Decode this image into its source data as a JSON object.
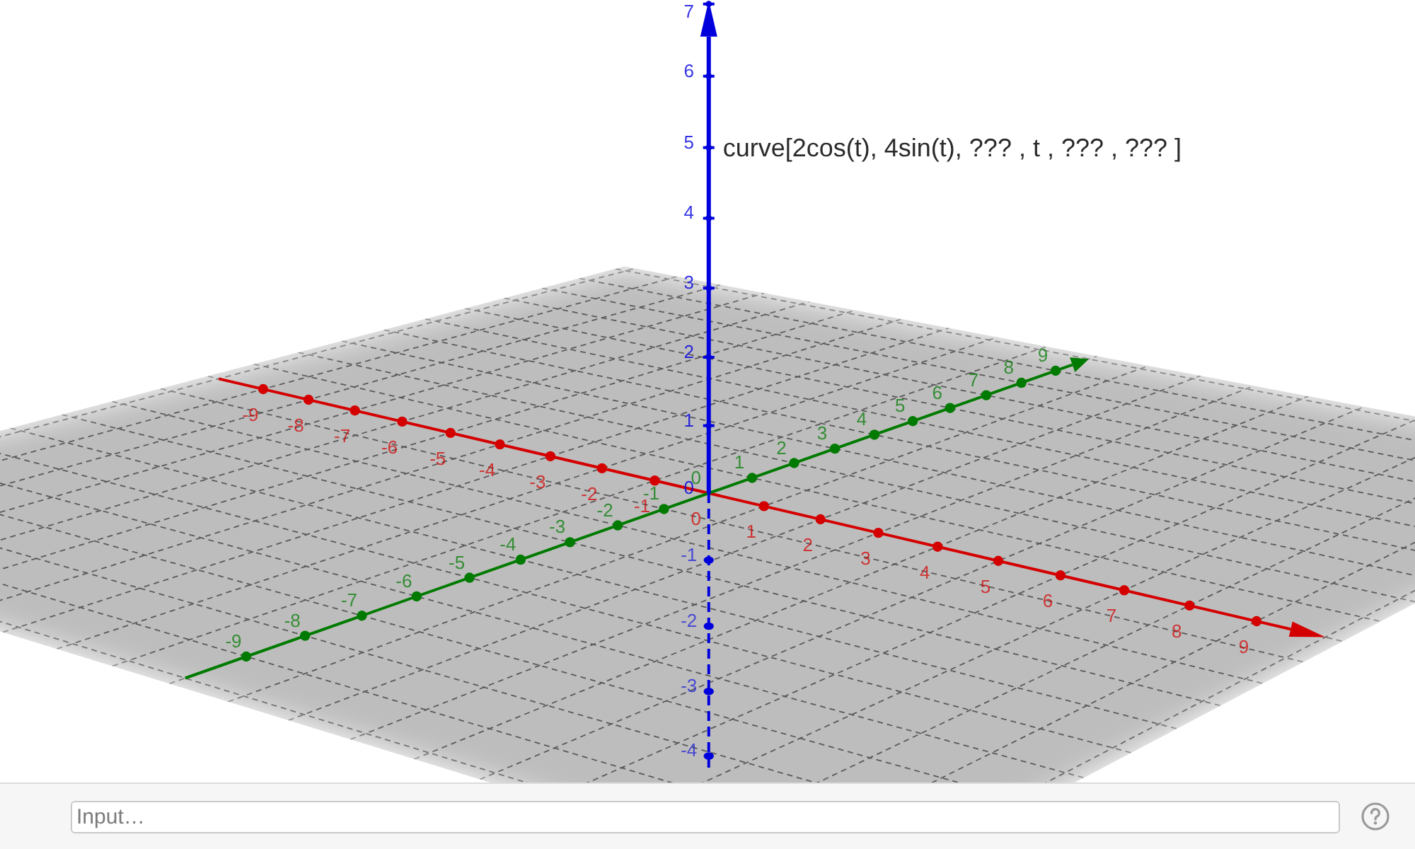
{
  "graphics_view": {
    "object_label": "curve[2cos(t), 4sin(t), ??? , t , ??? , ??? ]",
    "axes": [
      {
        "kind": "x",
        "color": "#d40000",
        "tick_labels": [
          "-9",
          "-8",
          "-7",
          "-6",
          "-5",
          "-4",
          "-3",
          "-2",
          "-1",
          "0",
          "1",
          "2",
          "3",
          "4",
          "5",
          "6",
          "7",
          "8",
          "9"
        ]
      },
      {
        "kind": "y",
        "color": "#007a00",
        "tick_labels": [
          "-9",
          "-8",
          "-7",
          "-6",
          "-5",
          "-4",
          "-3",
          "-2",
          "-1",
          "0",
          "1",
          "2",
          "3",
          "4",
          "5",
          "6",
          "7",
          "8",
          "9"
        ]
      },
      {
        "kind": "z",
        "color": "#0000dd",
        "tick_labels": [
          "7",
          "6",
          "5",
          "4",
          "3",
          "2",
          "1",
          "0",
          "-1",
          "-2",
          "-3",
          "-4"
        ]
      }
    ]
  },
  "input_bar": {
    "placeholder": "Input…"
  }
}
